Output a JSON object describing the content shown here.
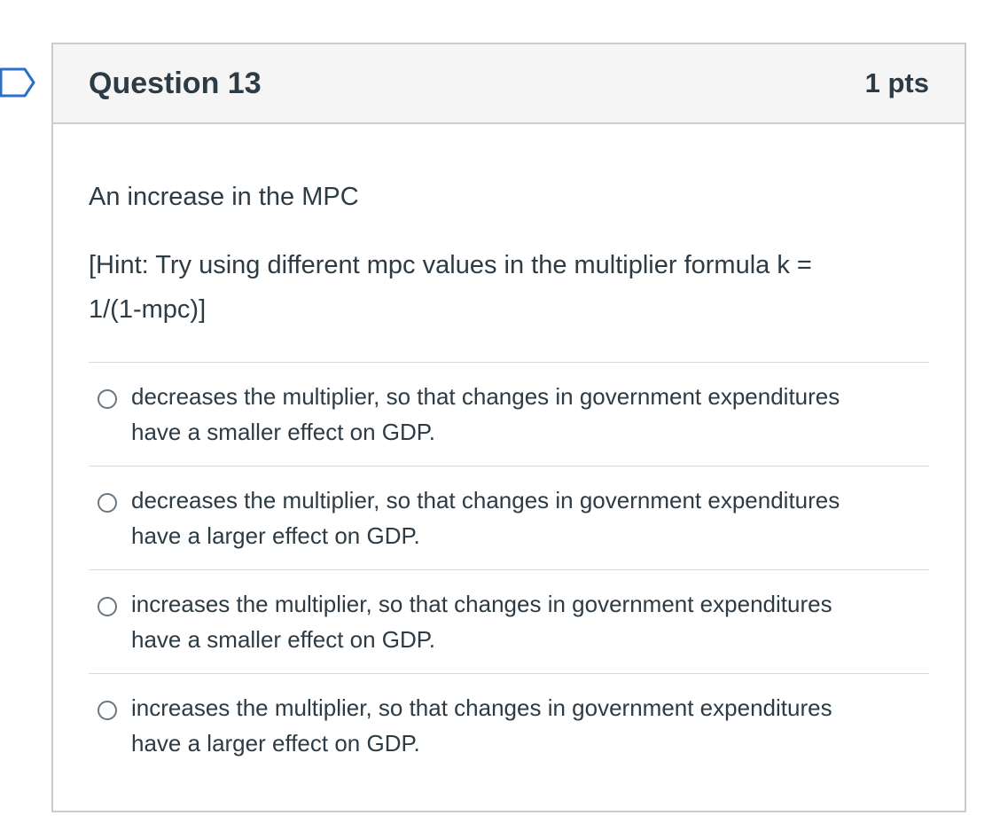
{
  "question": {
    "name": "Question 13",
    "points": "1 pts",
    "prompt": "An increase in the MPC",
    "hint_line1": "[Hint: Try using different mpc values in the multiplier formula k =",
    "hint_line2": "1/(1-mpc)]"
  },
  "answers": [
    {
      "line1": "decreases the multiplier, so that changes in government expenditures",
      "line2": "have a smaller effect on GDP."
    },
    {
      "line1": "decreases the multiplier, so that changes in government expenditures",
      "line2": "have a larger effect on GDP."
    },
    {
      "line1": "increases the multiplier, so that changes in government expenditures",
      "line2": "have a smaller effect on GDP."
    },
    {
      "line1": "increases the multiplier, so that changes in government expenditures",
      "line2": "have a larger effect on GDP."
    }
  ],
  "icons": {
    "flag": "flag-question-icon"
  },
  "colors": {
    "border": "#c7cdd1",
    "header_bg": "#f5f5f5",
    "text": "#2d3b45",
    "flag": "#2d6ec8"
  }
}
